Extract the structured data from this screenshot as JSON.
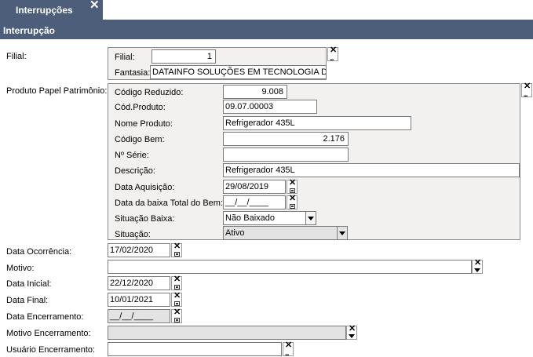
{
  "tab": {
    "label": "Interrupções",
    "close": "✕"
  },
  "header": {
    "title": "Interrupção"
  },
  "filial_section": {
    "label": "Filial:",
    "filial_label": "Filial:",
    "filial_value": "1",
    "fantasia_label": "Fantasia:",
    "fantasia_value": "DATAINFO SOLUÇÕES EM TECNOLOGIA DA II"
  },
  "produto_section": {
    "label": "Produto Papel Patrimônio:",
    "codigo_reduzido_label": "Código Reduzido:",
    "codigo_reduzido_value": "9.008",
    "cod_produto_label": "Cód.Produto:",
    "cod_produto_value": "09.07.00003",
    "nome_produto_label": "Nome Produto:",
    "nome_produto_value": "Refrigerador 435L",
    "codigo_bem_label": "Código Bem:",
    "codigo_bem_value": "2.176",
    "numero_serie_label": "Nº Série:",
    "numero_serie_value": "",
    "descricao_label": "Descrição:",
    "descricao_value": "Refrigerador 435L",
    "data_aquisicao_label": "Data Aquisição:",
    "data_aquisicao_value": "29/08/2019",
    "data_baixa_label": "Data da baixa Total do Bem:",
    "data_baixa_value": "__/__/____",
    "situacao_baixa_label": "Situação Baixa:",
    "situacao_baixa_value": "Não Baixado",
    "situacao_label": "Situação:",
    "situacao_value": "Ativo"
  },
  "form": {
    "data_ocorrencia_label": "Data Ocorrência:",
    "data_ocorrencia_value": "17/02/2020",
    "motivo_label": "Motivo:",
    "motivo_value": "",
    "data_inicial_label": "Data Inicial:",
    "data_inicial_value": "22/12/2020",
    "data_final_label": "Data Final:",
    "data_final_value": "10/01/2021",
    "data_encerramento_label": "Data Encerramento:",
    "data_encerramento_value": "__/__/____",
    "motivo_encerramento_label": "Motivo Encerramento:",
    "motivo_encerramento_value": "",
    "usuario_encerramento_label": "Usuário Encerramento:",
    "usuario_encerramento_value": ""
  },
  "icons": {
    "clear": "✕",
    "lookup": "...",
    "calendar": "calendar-icon",
    "dropdown": "chevron-down-icon"
  }
}
